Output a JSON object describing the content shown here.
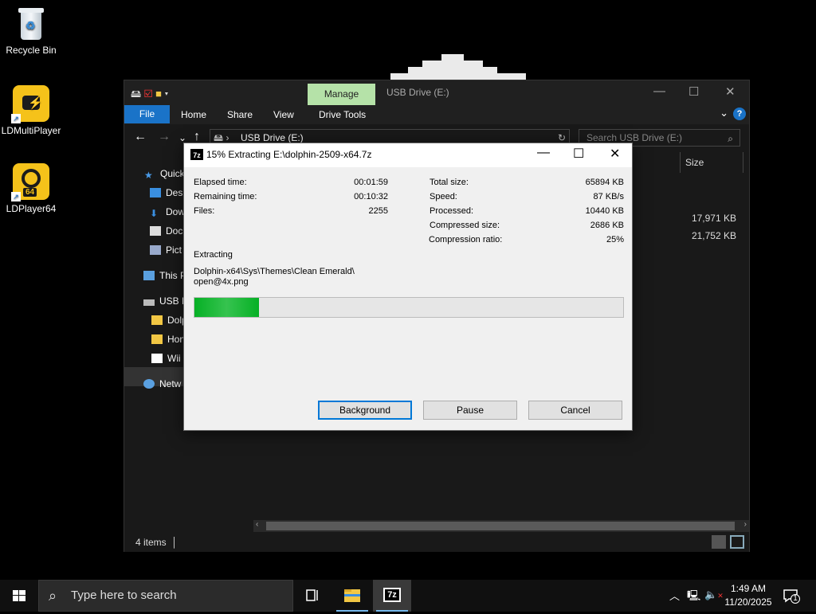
{
  "desktop": {
    "icons": [
      {
        "label": "Recycle Bin"
      },
      {
        "label": "LDMultiPlayer"
      },
      {
        "label": "LDPlayer64",
        "badge": "64"
      }
    ]
  },
  "explorer": {
    "manage_tab": "Manage",
    "title": "USB Drive (E:)",
    "ribbon": {
      "file": "File",
      "tabs": [
        "Home",
        "Share",
        "View",
        "Drive Tools"
      ]
    },
    "address": "USB Drive (E:)",
    "search_placeholder": "Search USB Drive (E:)",
    "nav": [
      "Quick",
      "Desl",
      "Dow",
      "Docu",
      "Pict",
      "This P",
      "USB D",
      "Dolp",
      "Hon",
      "Wii",
      "Netw"
    ],
    "column_size": "Size",
    "sizes": [
      "17,971 KB",
      "21,752 KB"
    ],
    "status": "4 items"
  },
  "dialog": {
    "title": "15% Extracting E:\\dolphin-2509-x64.7z",
    "icon_text": "7z",
    "left": [
      {
        "label": "Elapsed time:",
        "value": "00:01:59"
      },
      {
        "label": "Remaining time:",
        "value": "00:10:32"
      },
      {
        "label": "Files:",
        "value": "2255"
      }
    ],
    "right": [
      {
        "label": "Total size:",
        "value": "65894 KB"
      },
      {
        "label": "Speed:",
        "value": "87 KB/s"
      },
      {
        "label": "Processed:",
        "value": "10440 KB"
      },
      {
        "label": "Compressed size:",
        "value": "2686 KB"
      },
      {
        "label": "Compression ratio:",
        "value": "25%"
      }
    ],
    "extracting_label": "Extracting",
    "path_line1": "Dolphin-x64\\Sys\\Themes\\Clean Emerald\\",
    "path_line2": "open@4x.png",
    "progress": 0.15,
    "buttons": {
      "background": "Background",
      "pause": "Pause",
      "cancel": "Cancel"
    }
  },
  "taskbar": {
    "search_placeholder": "Type here to search",
    "time": "1:49 AM",
    "date": "11/20/2025",
    "notification_count": "1",
    "app_7z": "7z"
  },
  "colors": {
    "accent": "#1a73c8",
    "progress": "#06b025",
    "manage": "#b5e2a8"
  }
}
